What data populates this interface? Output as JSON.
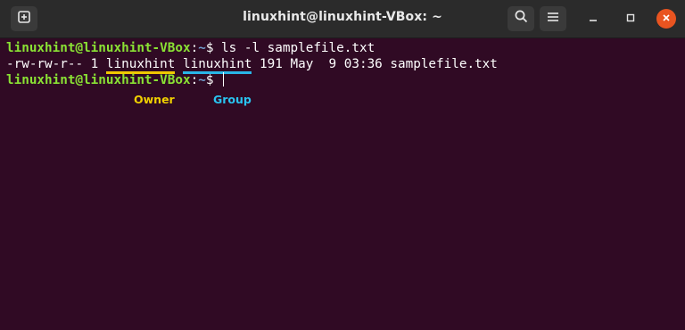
{
  "window": {
    "title": "linuxhint@linuxhint-VBox: ~"
  },
  "titlebar": {
    "icons": [
      "new-tab-icon",
      "search-icon",
      "hamburger-menu-icon",
      "minimize-icon",
      "maximize-icon",
      "close-icon"
    ]
  },
  "terminal": {
    "line1": {
      "user": "linuxhint@linuxhint-VBox",
      "colon": ":",
      "path": "~",
      "dollar": "$ ",
      "command": "ls -l samplefile.txt"
    },
    "line2": {
      "perms": "-rw-rw-r-- 1 ",
      "owner": "linuxhint",
      "space": " ",
      "group": "linuxhint",
      "rest": " 191 May  9 03:36 samplefile.txt"
    },
    "line3": {
      "user": "linuxhint@linuxhint-VBox",
      "colon": ":",
      "path": "~",
      "dollar": "$ "
    }
  },
  "annotations": {
    "owner_label": "Owner",
    "group_label": "Group",
    "owner_color": "#f0d000",
    "group_color": "#29c4f0"
  },
  "colors": {
    "terminal_bg": "#300a24",
    "titlebar_bg": "#2b2b2b",
    "prompt_user": "#8ae234",
    "prompt_path": "#729fcf",
    "close_button": "#e95420"
  }
}
